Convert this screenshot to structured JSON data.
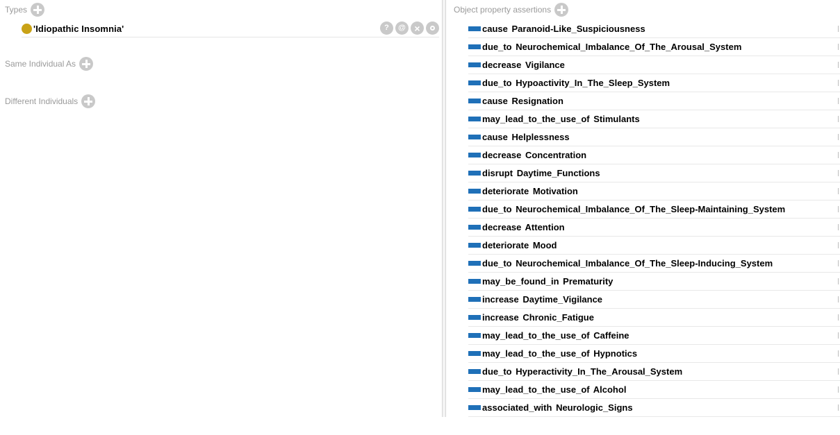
{
  "types": {
    "header": "Types",
    "items": [
      {
        "label": "'Idiopathic Insomnia'"
      }
    ],
    "actions": {
      "explain": "?",
      "annotate": "@",
      "delete": "×",
      "edit": "o"
    }
  },
  "same_individual": {
    "header": "Same Individual As"
  },
  "different_individuals": {
    "header": "Different Individuals"
  },
  "object_property_assertions": {
    "header": "Object property assertions",
    "items": [
      {
        "property": "cause",
        "value": "Paranoid-Like_Suspiciousness"
      },
      {
        "property": "due_to",
        "value": "Neurochemical_Imbalance_Of_The_Arousal_System"
      },
      {
        "property": "decrease",
        "value": "Vigilance"
      },
      {
        "property": "due_to",
        "value": "Hypoactivity_In_The_Sleep_System"
      },
      {
        "property": "cause",
        "value": "Resignation"
      },
      {
        "property": "may_lead_to_the_use_of",
        "value": "Stimulants"
      },
      {
        "property": "cause",
        "value": "Helplessness"
      },
      {
        "property": "decrease",
        "value": "Concentration"
      },
      {
        "property": "disrupt",
        "value": "Daytime_Functions"
      },
      {
        "property": "deteriorate",
        "value": "Motivation"
      },
      {
        "property": "due_to",
        "value": "Neurochemical_Imbalance_Of_The_Sleep-Maintaining_System"
      },
      {
        "property": "decrease",
        "value": "Attention"
      },
      {
        "property": "deteriorate",
        "value": "Mood"
      },
      {
        "property": "due_to",
        "value": "Neurochemical_Imbalance_Of_The_Sleep-Inducing_System"
      },
      {
        "property": "may_be_found_in",
        "value": "Prematurity"
      },
      {
        "property": "increase",
        "value": "Daytime_Vigilance"
      },
      {
        "property": "increase",
        "value": "Chronic_Fatigue"
      },
      {
        "property": "may_lead_to_the_use_of",
        "value": "Caffeine"
      },
      {
        "property": "may_lead_to_the_use_of",
        "value": "Hypnotics"
      },
      {
        "property": "due_to",
        "value": "Hyperactivity_In_The_Arousal_System"
      },
      {
        "property": "may_lead_to_the_use_of",
        "value": "Alcohol"
      },
      {
        "property": "associated_with",
        "value": "Neurologic_Signs"
      }
    ]
  },
  "colors": {
    "individual_class": "#c9a216",
    "object_property": "#1f70b8",
    "section_label": "#9a9a9a",
    "button_grey": "#c9c9c9"
  },
  "icons": {
    "class": "class-icon",
    "object_property": "object-property-icon",
    "add": "add-icon"
  }
}
